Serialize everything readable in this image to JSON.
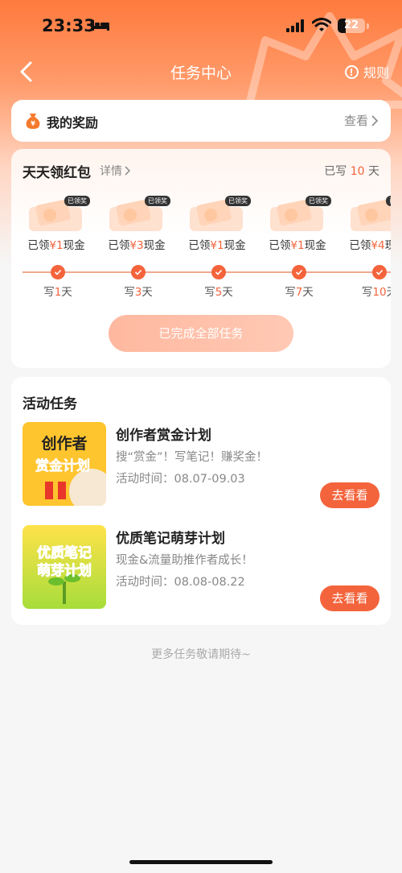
{
  "status_bar": {
    "time": "23:33",
    "battery": "22"
  },
  "nav": {
    "title": "任务中心",
    "rules": "规则"
  },
  "rewards": {
    "title": "我的奖励",
    "view": "查看"
  },
  "daily": {
    "title": "天天领红包",
    "detail": "详情",
    "status_prefix": "已写",
    "status_count": "10",
    "status_suffix": "天",
    "badge": "已领奖",
    "items": [
      {
        "prefix": "已领",
        "amount": "¥1",
        "suffix": "现金",
        "day_prefix": "写",
        "day": "1",
        "day_suffix": "天"
      },
      {
        "prefix": "已领",
        "amount": "¥3",
        "suffix": "现金",
        "day_prefix": "写",
        "day": "3",
        "day_suffix": "天"
      },
      {
        "prefix": "已领",
        "amount": "¥1",
        "suffix": "现金",
        "day_prefix": "写",
        "day": "5",
        "day_suffix": "天"
      },
      {
        "prefix": "已领",
        "amount": "¥1",
        "suffix": "现金",
        "day_prefix": "写",
        "day": "7",
        "day_suffix": "天"
      },
      {
        "prefix": "已领",
        "amount": "¥4",
        "suffix": "现金",
        "day_prefix": "写",
        "day": "10",
        "day_suffix": "天"
      }
    ],
    "complete_button": "已完成全部任务"
  },
  "tasks": {
    "title": "活动任务",
    "items": [
      {
        "name": "创作者赏金计划",
        "desc": "搜“赏金”！写笔记！赚奖金！",
        "time": "活动时间：08.07-09.03",
        "button": "去看看",
        "thumb_line1": "创作者",
        "thumb_line2": "赏金计划"
      },
      {
        "name": "优质笔记萌芽计划",
        "desc": "现金&流量助推作者成长！",
        "time": "活动时间：08.08-08.22",
        "button": "去看看",
        "thumb_line1": "优质笔记",
        "thumb_line2": "萌芽计划"
      }
    ]
  },
  "footer": {
    "more": "更多任务敬请期待~"
  },
  "colors": {
    "accent": "#f4643c",
    "hero_top": "#ff7a3d"
  },
  "icons": [
    "back-arrow-icon",
    "info-icon",
    "money-bag-icon",
    "chevron-right-icon",
    "check-icon",
    "bed-icon",
    "signal-icon",
    "wifi-icon"
  ]
}
